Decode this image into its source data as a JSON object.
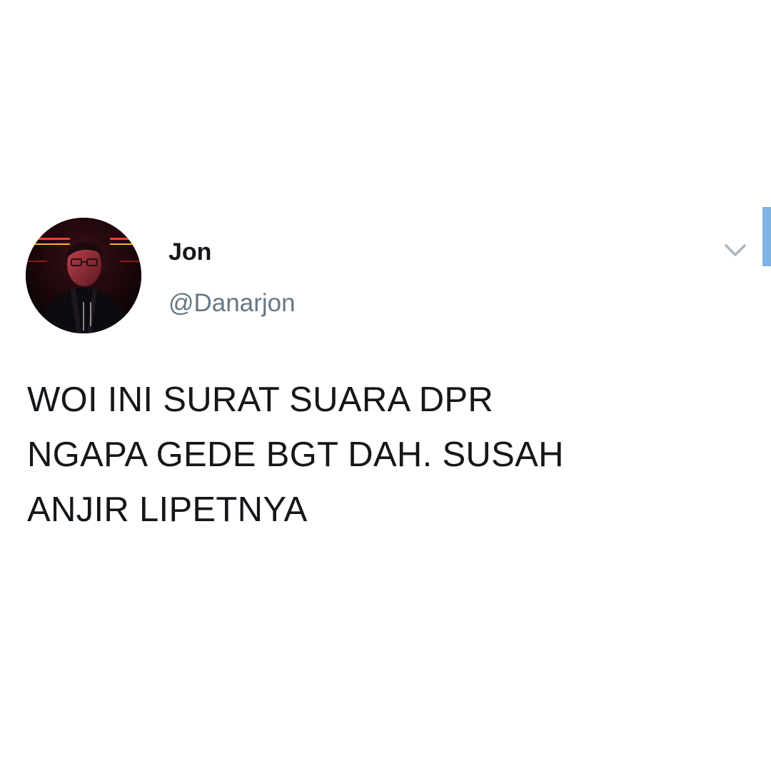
{
  "tweet": {
    "author": {
      "display_name": "Jon",
      "handle": "@Danarjon"
    },
    "text_lines": [
      "WOI INI SURAT SUARA DPR",
      "NGAPA GEDE BGT DAH. SUSAH",
      "ANJIR LIPETNYA"
    ],
    "menu_icon": "chevron-down-icon"
  },
  "colors": {
    "background": "#ffffff",
    "text_primary": "#14171a",
    "text_secondary": "#657786",
    "icon": "#aab8c2",
    "scroll_indicator": "#7fb2e5"
  }
}
